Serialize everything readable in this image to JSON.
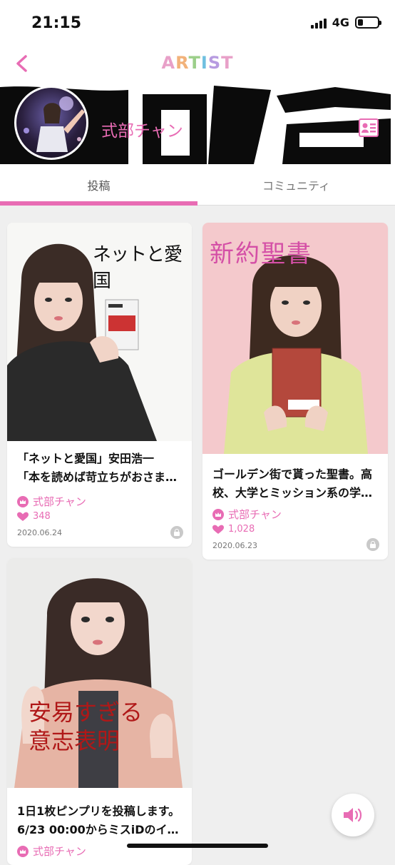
{
  "status": {
    "time": "21:15",
    "network": "4G",
    "signal_bars": 4,
    "battery_level": 0.25
  },
  "nav": {
    "title_letters": [
      "A",
      "R",
      "T",
      "I",
      "S",
      "T"
    ],
    "title_colors": [
      "#e8a0c8",
      "#f2b27a",
      "#9ccf8a",
      "#6fbfe0",
      "#b79be0",
      "#e8a0c8"
    ]
  },
  "header": {
    "artist_name": "式部チャン"
  },
  "tabs": [
    {
      "label": "投稿",
      "active": true
    },
    {
      "label": "コミュニティ",
      "active": false
    }
  ],
  "posts": [
    {
      "image_caption": "ネットと愛国",
      "title_line1": "「ネットと愛国」安田浩一",
      "title_line2": "「本を読めば苛立ちがおさま…",
      "author": "式部チャン",
      "likes": "348",
      "date": "2020.06.24"
    },
    {
      "image_caption": "新約聖書",
      "title_line1": "ゴールデン街で貰った聖書。高",
      "title_line2": "校、大学とミッション系の学…",
      "author": "式部チャン",
      "likes": "1,028",
      "date": "2020.06.23"
    },
    {
      "image_caption": "安易すぎる意志表明",
      "title_line1": "1日1枚ピンプリを投稿します。",
      "title_line2": "6/23 00:00からミスiDのイ…",
      "author": "式部チャン",
      "likes": "",
      "date": ""
    }
  ],
  "colors": {
    "accent": "#e86cb4",
    "background": "#efefef"
  }
}
